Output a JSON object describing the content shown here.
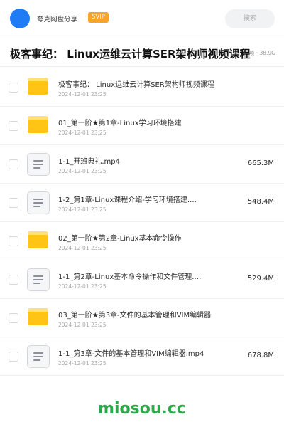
{
  "header": {
    "share_title": "夸克网盘分享",
    "svip_badge": "SVIP",
    "search_placeholder": "搜索"
  },
  "title_bar": {
    "title": "极客事纪： Linux运维云计算SER架构师视频课程",
    "meta": "项 · 38.9G"
  },
  "files": [
    {
      "type": "folder",
      "name": "极客事纪： Linux运维云计算SER架构师视频课程",
      "date": "2024-12-01 23:25",
      "size": ""
    },
    {
      "type": "folder",
      "name": "01_第一阶★第1章-Linux学习环境搭建",
      "date": "2024-12-01 23:25",
      "size": ""
    },
    {
      "type": "file",
      "name": "1-1_开班典礼.mp4",
      "date": "2024-12-01 23:25",
      "size": "665.3M"
    },
    {
      "type": "file",
      "name": "1-2_第1章-Linux课程介绍-学习环境搭建.…",
      "date": "2024-12-01 23:25",
      "size": "548.4M"
    },
    {
      "type": "folder",
      "name": "02_第一阶★第2章-Linux基本命令操作",
      "date": "2024-12-01 23:25",
      "size": ""
    },
    {
      "type": "file",
      "name": "1-1_第2章-Linux基本命令操作和文件管理.…",
      "date": "2024-12-01 23:25",
      "size": "529.4M"
    },
    {
      "type": "folder",
      "name": "03_第一阶★第3章-文件的基本管理和VIM编辑器",
      "date": "2024-12-01 23:25",
      "size": ""
    },
    {
      "type": "file",
      "name": "1-1_第3章-文件的基本管理和VIM编辑器.mp4",
      "date": "2024-12-01 23:25",
      "size": "678.8M"
    }
  ],
  "watermark": "miosou.cc",
  "colors": {
    "avatar": "#1f7cf5",
    "svip": "#f8a42a",
    "folder": "#ffc414",
    "watermark": "#2fa84a"
  }
}
